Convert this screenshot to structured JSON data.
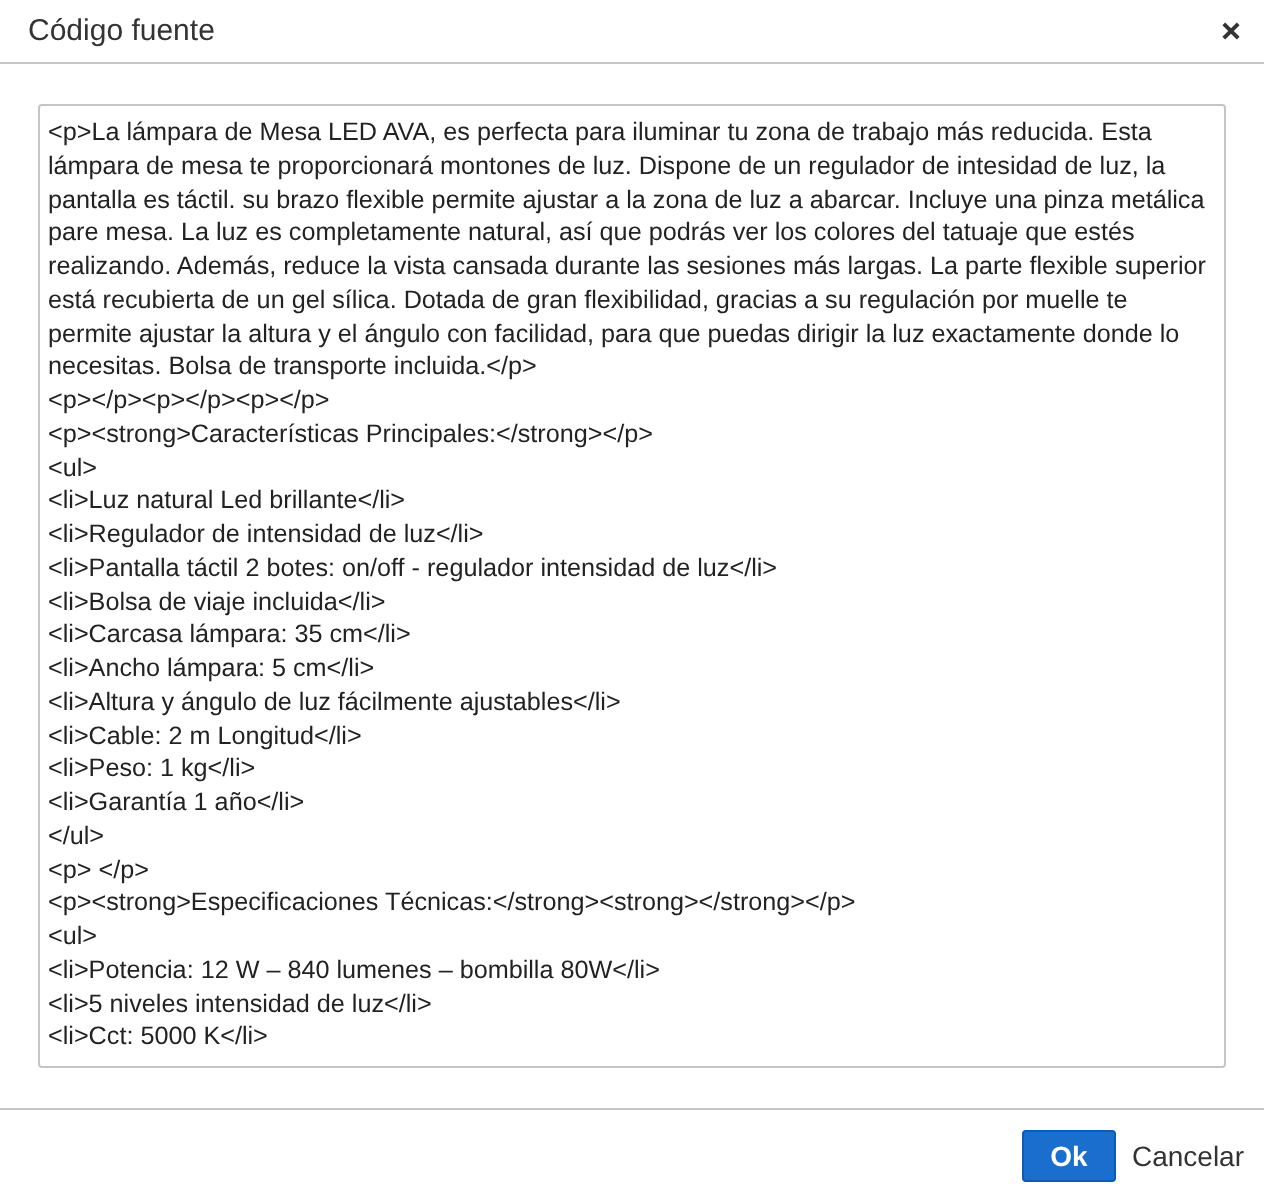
{
  "dialog": {
    "title": "Código fuente"
  },
  "source_code": {
    "lines": [
      "<p>La lámpara de Mesa LED AVA, es perfecta para iluminar tu zona de trabajo más reducida. Esta lámpara de mesa te proporcionará montones de luz. Dispone de un regulador de intesidad de luz, la pantalla es táctil. su brazo flexible permite ajustar a la zona de luz a abarcar. Incluye una pinza metálica pare mesa. La luz es completamente natural, así que podrás ver los colores del tatuaje que estés realizando. Además, reduce la vista cansada durante las sesiones más largas. La parte flexible superior está recubierta de un gel sílica. Dotada de gran flexibilidad, gracias a su regulación por muelle te permite ajustar la altura y el ángulo con facilidad, para que puedas dirigir la luz exactamente donde lo necesitas. Bolsa de transporte incluida.</p>",
      "<p></p><p></p><p></p>",
      "<p><strong>Características Principales:</strong></p>",
      "<ul>",
      "<li>Luz natural Led brillante</li>",
      "<li>Regulador de intensidad de luz</li>",
      "<li>Pantalla táctil 2 botes: on/off - regulador intensidad de luz</li>",
      "<li>Bolsa de viaje incluida</li>",
      "<li>Carcasa lámpara: 35 cm</li>",
      "<li>Ancho lámpara: 5 cm</li>",
      "<li>Altura y ángulo de luz fácilmente ajustables</li>",
      "<li>Cable: 2 m Longitud</li>",
      "<li>Peso: 1 kg</li>",
      "<li>Garantía 1 año</li>",
      "</ul>",
      "<p> </p>",
      "<p><strong>Especificaciones Técnicas:</strong><strong></strong></p>",
      "<ul>",
      "<li>Potencia: 12 W – 840 lumenes – bombilla 80W</li>",
      "<li>5 niveles intensidad de luz</li>",
      "<li>Cct: 5000 K</li>"
    ]
  },
  "buttons": [
    {
      "kind": "primary",
      "label": "Ok"
    },
    {
      "kind": "plain",
      "label": "Cancelar"
    }
  ]
}
